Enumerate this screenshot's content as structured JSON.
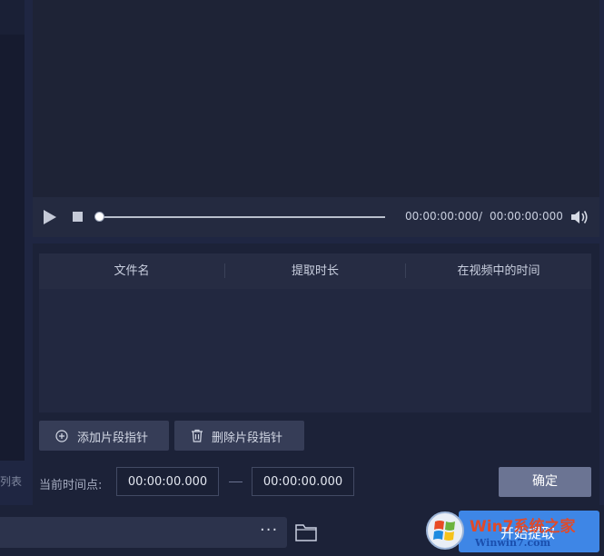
{
  "left_panel": {
    "list_label": "列表"
  },
  "player": {
    "time_current": "00:00:00:000",
    "time_separator": "/",
    "time_total": "00:00:00:000",
    "progress": 0
  },
  "segments": {
    "columns": [
      "文件名",
      "提取时长",
      "在视频中的时间"
    ],
    "rows": [],
    "add_label": "添加片段指针",
    "delete_label": "删除片段指针",
    "current_time_label": "当前时间点:",
    "start_time": "00:00:00.000",
    "end_time": "00:00:00.000",
    "confirm_label": "确定"
  },
  "bottom": {
    "output_path": "",
    "more_label": "···",
    "start_label": "开始提取"
  },
  "watermark": {
    "brand": "Win7系统之家",
    "url": "Winwin7.com"
  },
  "colors": {
    "background": "#1f2642",
    "panel": "#1c2238",
    "button": "#363d57",
    "confirm": "#6b7493",
    "accent": "#3e86e6"
  }
}
